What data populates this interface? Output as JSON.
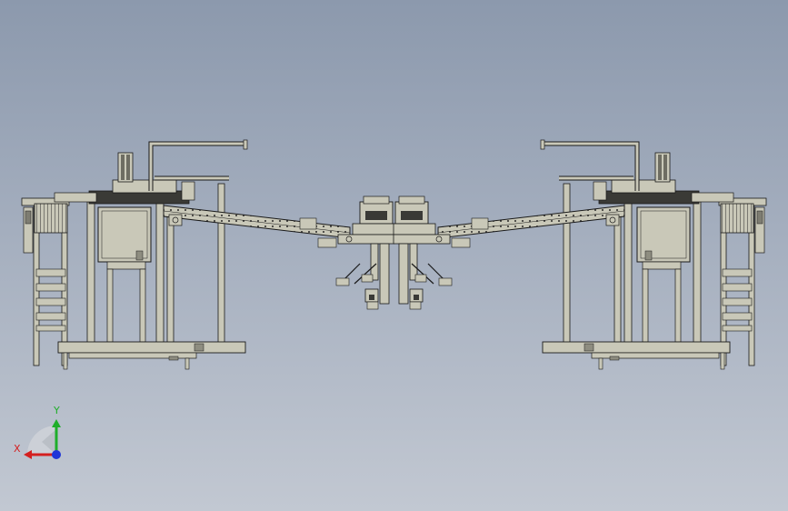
{
  "view": {
    "background_top": "#8c99ad",
    "background_bottom": "#c2c8d2",
    "line_color": "#1a1a1a",
    "part_fill": "#c9c8b8",
    "part_fill_dark": "#8e8d80"
  },
  "triad": {
    "x_label": "X",
    "y_label": "Y",
    "x_color": "#d42020",
    "y_color": "#1fae2a",
    "z_color": "#1e34d8",
    "icon": "coordinate-triad-icon"
  }
}
